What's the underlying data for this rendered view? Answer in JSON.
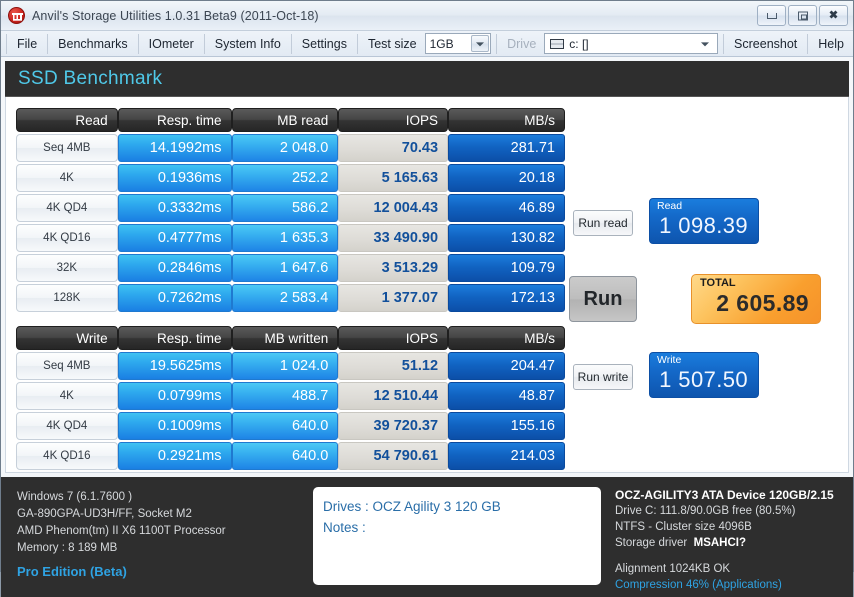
{
  "window": {
    "title": "Anvil's Storage Utilities 1.0.31 Beta9 (2011-Oct-18)",
    "icon": "anvil-app-icon",
    "controls": {
      "minimize": "minimize-icon",
      "maximize": "maximize-icon",
      "close": "close-icon"
    }
  },
  "menu": {
    "items": [
      "File",
      "Benchmarks",
      "IOmeter",
      "System Info",
      "Settings"
    ],
    "test_size_label": "Test size",
    "test_size_value": "1GB",
    "drive_label": "Drive",
    "drive_value": "c: []",
    "screenshot": "Screenshot",
    "help": "Help"
  },
  "banner": {
    "title": "SSD Benchmark"
  },
  "read_table": {
    "headers": [
      "Read",
      "Resp. time",
      "MB read",
      "IOPS",
      "MB/s"
    ],
    "rows": [
      {
        "label": "Seq 4MB",
        "resp": "14.1992ms",
        "mb": "2 048.0",
        "iops": "70.43",
        "mbs": "281.71"
      },
      {
        "label": "4K",
        "resp": "0.1936ms",
        "mb": "252.2",
        "iops": "5 165.63",
        "mbs": "20.18"
      },
      {
        "label": "4K QD4",
        "resp": "0.3332ms",
        "mb": "586.2",
        "iops": "12 004.43",
        "mbs": "46.89"
      },
      {
        "label": "4K QD16",
        "resp": "0.4777ms",
        "mb": "1 635.3",
        "iops": "33 490.90",
        "mbs": "130.82"
      },
      {
        "label": "32K",
        "resp": "0.2846ms",
        "mb": "1 647.6",
        "iops": "3 513.29",
        "mbs": "109.79"
      },
      {
        "label": "128K",
        "resp": "0.7262ms",
        "mb": "2 583.4",
        "iops": "1 377.07",
        "mbs": "172.13"
      }
    ]
  },
  "write_table": {
    "headers": [
      "Write",
      "Resp. time",
      "MB written",
      "IOPS",
      "MB/s"
    ],
    "rows": [
      {
        "label": "Seq 4MB",
        "resp": "19.5625ms",
        "mb": "1 024.0",
        "iops": "51.12",
        "mbs": "204.47"
      },
      {
        "label": "4K",
        "resp": "0.0799ms",
        "mb": "488.7",
        "iops": "12 510.44",
        "mbs": "48.87"
      },
      {
        "label": "4K QD4",
        "resp": "0.1009ms",
        "mb": "640.0",
        "iops": "39 720.37",
        "mbs": "155.16"
      },
      {
        "label": "4K QD16",
        "resp": "0.2921ms",
        "mb": "640.0",
        "iops": "54 790.61",
        "mbs": "214.03"
      }
    ]
  },
  "actions": {
    "run_read": "Run read",
    "run": "Run",
    "run_write": "Run write"
  },
  "scores": {
    "read_label": "Read",
    "read_value": "1 098.39",
    "total_label": "TOTAL",
    "total_value": "2 605.89",
    "write_label": "Write",
    "write_value": "1 507.50"
  },
  "sysinfo": {
    "os": "Windows 7 (6.1.7600 )",
    "board": "GA-890GPA-UD3H/FF, Socket M2",
    "cpu": "AMD Phenom(tm) II X6 1100T Processor",
    "memory": "Memory : 8 189 MB",
    "edition": "Pro Edition (Beta)"
  },
  "notes": {
    "drives": "Drives : OCZ Agility 3 120 GB",
    "notes": "Notes :"
  },
  "driveinfo": {
    "device": "OCZ-AGILITY3 ATA Device 120GB/2.15",
    "capacity": "Drive C: 111.8/90.0GB free (80.5%)",
    "filesystem": "NTFS - Cluster size 4096B",
    "driver_label": "Storage driver",
    "driver_value": "MSAHCI?",
    "alignment": "Alignment 1024KB OK",
    "compression": "Compression 46% (Applications)"
  },
  "colors": {
    "accent_cyan": "#4fc8e8",
    "resp_blue": "#2ea9ee",
    "mbs_blue": "#1163c2",
    "iops_bg": "#dedcd7",
    "total_orange": "#f99f2e",
    "footer_bg": "#2e2e2e",
    "link_blue": "#2fa3e3"
  }
}
